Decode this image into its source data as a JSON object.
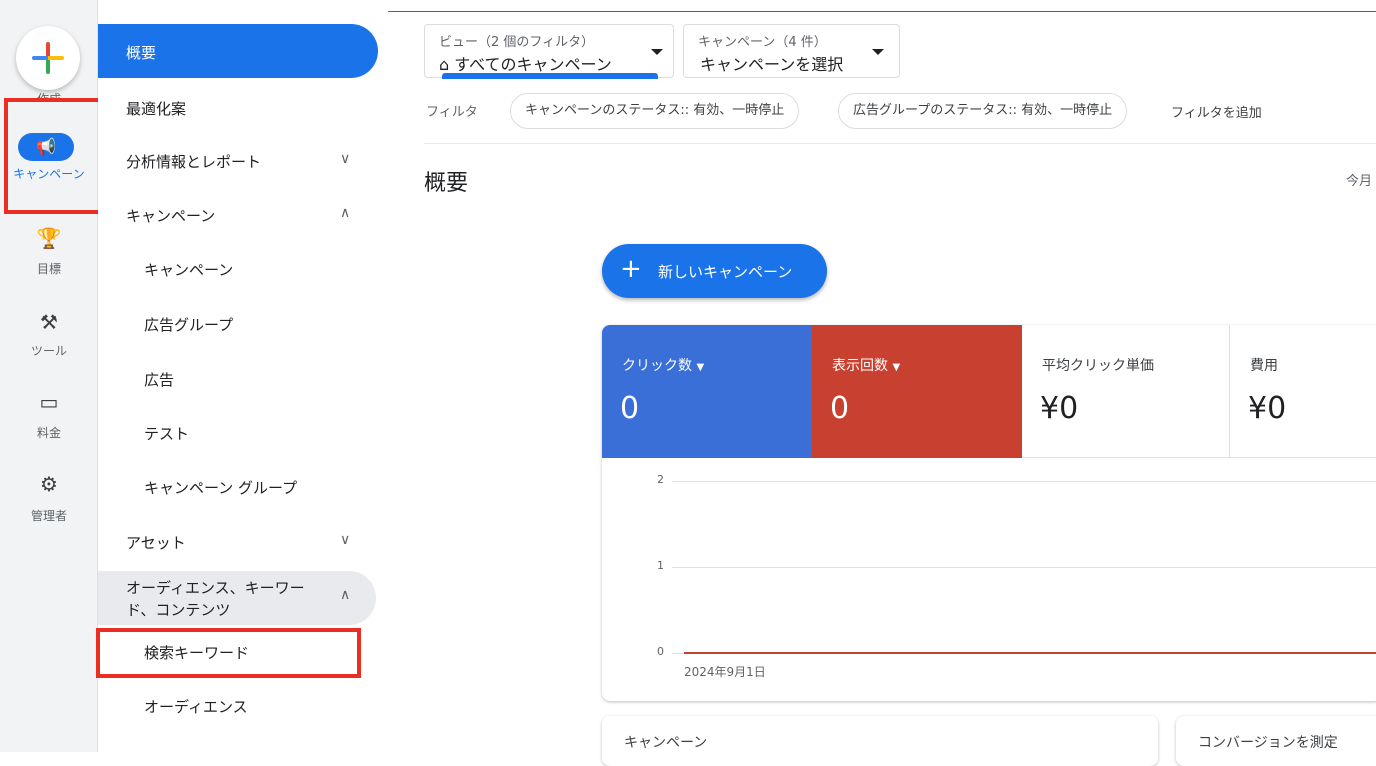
{
  "rail": {
    "create_label": "作成",
    "items": [
      {
        "icon": "megaphone-icon",
        "glyph": "📢",
        "label": "キャンペーン"
      },
      {
        "icon": "trophy-icon",
        "glyph": "🏆",
        "label": "目標"
      },
      {
        "icon": "tools-icon",
        "glyph": "⚒",
        "label": "ツール"
      },
      {
        "icon": "credit-card-icon",
        "glyph": "▭",
        "label": "料金"
      },
      {
        "icon": "gear-icon",
        "glyph": "⚙",
        "label": "管理者"
      }
    ]
  },
  "nav": {
    "items": [
      {
        "label": "概要"
      },
      {
        "label": "最適化案"
      },
      {
        "label": "分析情報とレポート",
        "chevron": "∨"
      },
      {
        "label": "キャンペーン",
        "chevron": "∧"
      },
      {
        "label": "キャンペーン"
      },
      {
        "label": "広告グループ"
      },
      {
        "label": "広告"
      },
      {
        "label": "テスト"
      },
      {
        "label": "キャンペーン グループ"
      },
      {
        "label": "アセット",
        "chevron": "∨"
      },
      {
        "label": "オーディエンス、キーワード、コンテンツ",
        "label_line1": "オーディエンス、キーワー",
        "label_line2": "ド、コンテンツ",
        "chevron": "∧"
      },
      {
        "label": "検索キーワード"
      },
      {
        "label": "オーディエンス"
      }
    ]
  },
  "header": {
    "view_dropdown": {
      "small": "ビュー（2 個のフィルタ）",
      "value": "すべてのキャンペーン"
    },
    "campaign_dropdown": {
      "small": "キャンペーン（4 件）",
      "value": "キャンペーンを選択"
    },
    "filter_label": "フィルタ",
    "chips": [
      "キャンペーンのステータス:: 有効、一時停止",
      "広告グループのステータス:: 有効、一時停止"
    ],
    "add_filter": "フィルタを追加"
  },
  "main": {
    "title": "概要",
    "date_partial": "今月",
    "new_campaign_button": "新しいキャンペーン",
    "metrics": [
      {
        "label": "クリック数",
        "value": "0",
        "color": "#3a6fd8",
        "dropdown": true
      },
      {
        "label": "表示回数",
        "value": "0",
        "color": "#c8402f",
        "dropdown": true
      },
      {
        "label": "平均クリック単価",
        "value": "¥0",
        "color": "#ffffff",
        "dropdown": false
      },
      {
        "label": "費用",
        "value": "¥0",
        "color": "#ffffff",
        "dropdown": false
      }
    ],
    "bottom_cards": [
      "キャンペーン",
      "コンバージョンを測定"
    ]
  },
  "chart_data": {
    "type": "line",
    "x": [
      "2024年9月1日"
    ],
    "series": [
      {
        "name": "クリック数",
        "values": [
          0
        ],
        "color": "#3a6fd8"
      },
      {
        "name": "表示回数",
        "values": [
          0
        ],
        "color": "#c8402f"
      }
    ],
    "yticks": [
      0,
      1,
      2
    ],
    "ylim": [
      0,
      2
    ],
    "xlabel": "2024年9月1日",
    "grid": true
  }
}
